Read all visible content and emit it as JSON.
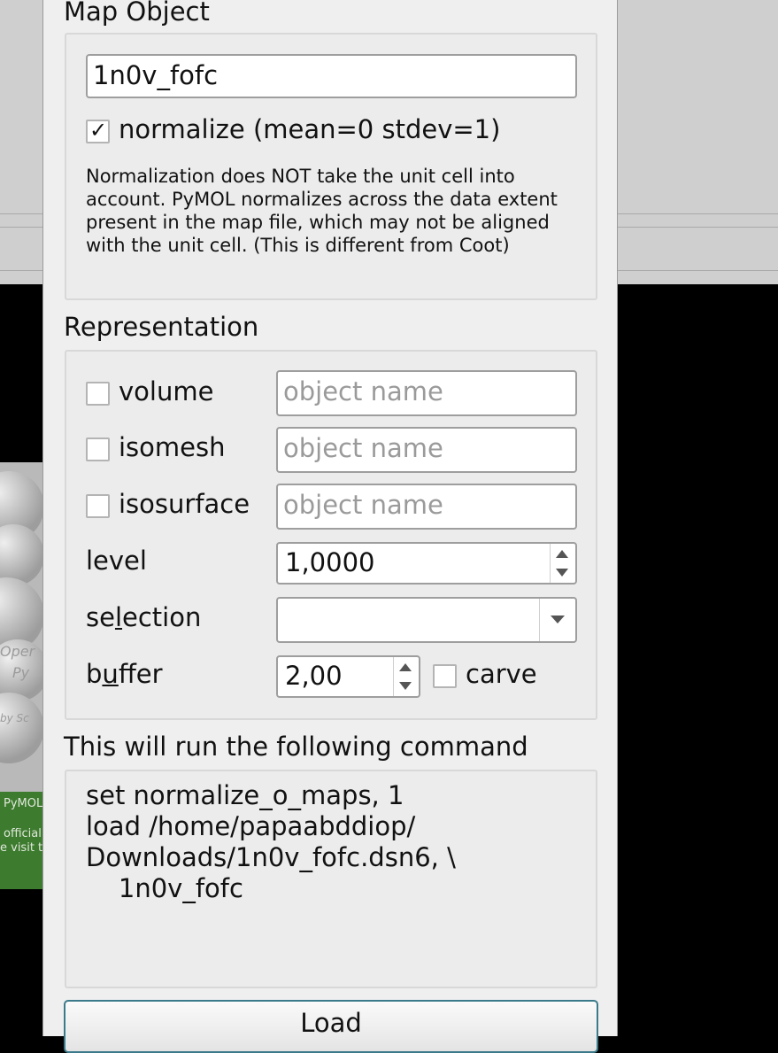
{
  "dialog": {
    "map_object": {
      "title": "Map Object",
      "name_value": "1n0v_fofc",
      "normalize_checked": true,
      "normalize_label": "normalize (mean=0 stdev=1)",
      "note": "Normalization does NOT take the unit cell into account. PyMOL normalizes across the data extent present in the map file, which may not be aligned with the unit cell. (This is different from Coot)"
    },
    "representation": {
      "title": "Representation",
      "volume_label": "volume",
      "isomesh_label": "isomesh",
      "isosurface_label": "isosurface",
      "object_placeholder": "object name",
      "level_label": "level",
      "level_value": "1,0000",
      "selection_label_pre": "se",
      "selection_label_u": "l",
      "selection_label_post": "ection",
      "selection_value": "",
      "buffer_label_pre": "b",
      "buffer_label_u": "u",
      "buffer_label_post": "ffer",
      "buffer_value": "2,00",
      "carve_label": "carve"
    },
    "command": {
      "title": "This will run the following command",
      "text": "set normalize_o_maps, 1\nload /home/papaabddiop/\nDownloads/1n0v_fofc.dsn6, \\\n    1n0v_fofc"
    },
    "load_label": "Load"
  },
  "background": {
    "ghost_text_1": "Oper",
    "ghost_text_2": "Py",
    "ghost_text_3": "by Sc",
    "footer_1": "PyMOL",
    "footer_2": "official",
    "footer_3": "e visit t"
  }
}
